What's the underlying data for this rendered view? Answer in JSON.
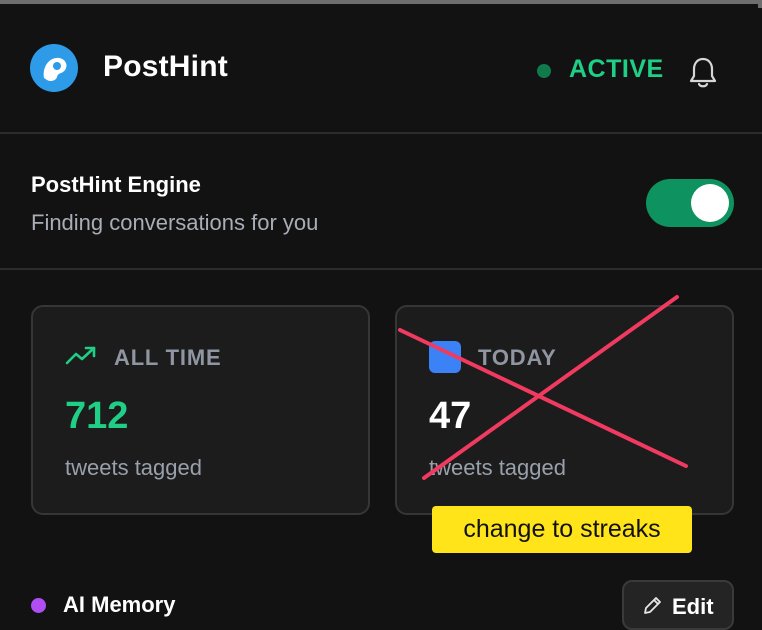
{
  "header": {
    "app_name": "PostHint",
    "status": "ACTIVE",
    "colors": {
      "logo": "#2e9be8",
      "status_text": "#1fcf86",
      "status_dot": "#117a4d"
    },
    "icons": {
      "logo": "posthint-logo-icon",
      "notifications": "bell-icon"
    }
  },
  "engine": {
    "title": "PostHint Engine",
    "subtitle": "Finding conversations for you",
    "toggle_on": true,
    "colors": {
      "toggle_track": "#0d9260"
    }
  },
  "stats": {
    "all_time": {
      "label": "ALL TIME",
      "value": "712",
      "caption": "tweets tagged",
      "icon": "trending-up-icon",
      "value_color": "#1fcf86"
    },
    "today": {
      "label": "TODAY",
      "value": "47",
      "caption": "tweets tagged",
      "icon": "calendar-icon",
      "value_color": "#ffffff"
    }
  },
  "annotation": {
    "note": "change to streaks",
    "mark": "red-cross-over-today-card",
    "colors": {
      "note_bg": "#ffe41a",
      "cross": "#f03a60"
    }
  },
  "memory": {
    "label": "AI Memory",
    "edit_label": "Edit",
    "colors": {
      "dot": "#b04ef4"
    },
    "icons": {
      "edit": "pencil-icon"
    }
  }
}
